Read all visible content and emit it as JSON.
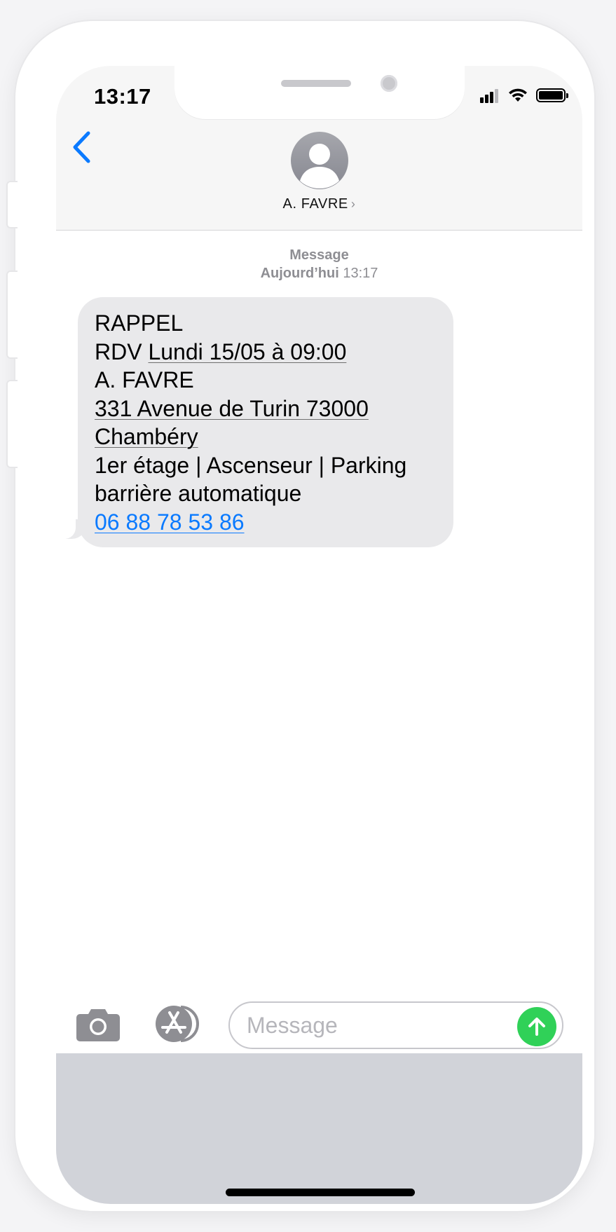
{
  "status_bar": {
    "time": "13:17",
    "icons": [
      "cellular-signal-icon",
      "wifi-icon",
      "battery-icon"
    ]
  },
  "header": {
    "contact_name": "A. FAVRE",
    "chevron": "›",
    "icons": [
      "back-chevron-icon",
      "contact-avatar-icon"
    ]
  },
  "conversation": {
    "service_label": "Message",
    "day": "Aujourd’hui",
    "time": "13:17",
    "message_lines": {
      "l1": "RAPPEL",
      "l2_prefix": "RDV ",
      "l2_date": "Lundi 15/05 à 09:00",
      "l3": "A. FAVRE",
      "l4": "331 Avenue de Turin 73000",
      "l5": "Chambéry",
      "l6": "1er étage | Ascenseur | Parking",
      "l7": "barrière automatique",
      "phone": "06 88 78 53 86"
    }
  },
  "input_bar": {
    "placeholder": "Message",
    "icons": [
      "camera-icon",
      "app-store-icon",
      "send-arrow-icon"
    ]
  },
  "colors": {
    "accent_blue": "#0a7aff",
    "send_green": "#30d158",
    "bubble_gray": "#e9e9eb",
    "keyboard_gray": "#d1d3d9"
  }
}
